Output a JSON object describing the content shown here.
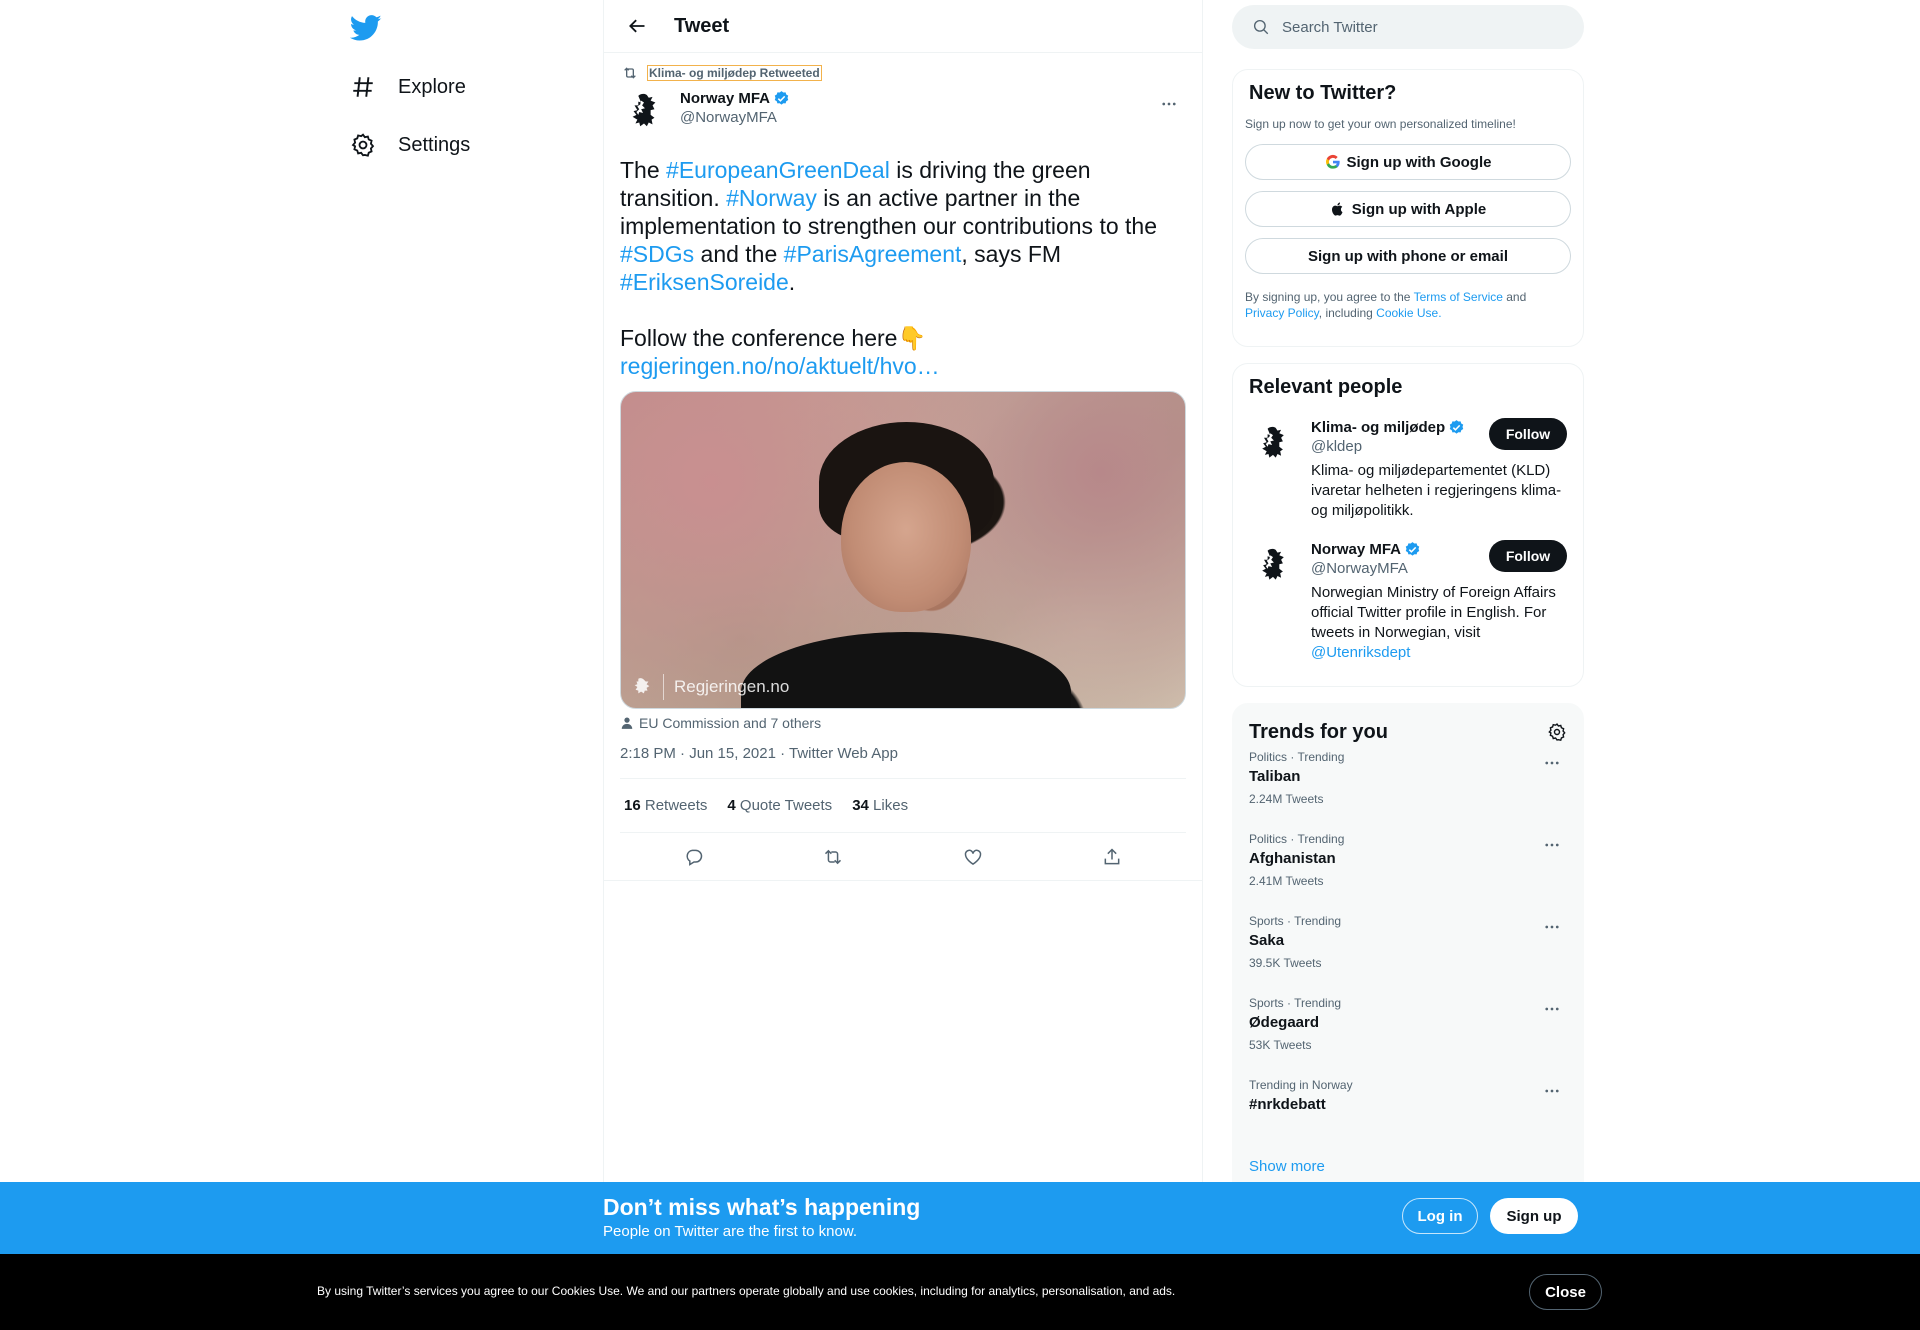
{
  "nav": {
    "logo": "twitter-bird-icon",
    "items": [
      {
        "label": "Explore",
        "icon": "hashtag-icon"
      },
      {
        "label": "Settings",
        "icon": "gear-icon"
      }
    ]
  },
  "header": {
    "title": "Tweet"
  },
  "tweet": {
    "retweeted_by": "Klima- og miljødep Retweeted",
    "author_name": "Norway MFA",
    "author_handle": "@NorwayMFA",
    "text": {
      "p1_a": "The ",
      "p1_tag1": "#EuropeanGreenDeal",
      "p1_b": " is driving the green transition. ",
      "p1_tag2": "#Norway",
      "p1_c": " is an active partner in the implementation to strengthen our contributions to the ",
      "p1_tag3": "#SDGs",
      "p1_d": " and the ",
      "p1_tag4": "#ParisAgreement",
      "p1_e": ", says FM ",
      "p1_tag5": "#EriksenSoreide",
      "p1_f": ".",
      "p2": "Follow the conference here👇",
      "link": "regjeringen.no/no/aktuelt/hvo…"
    },
    "media_watermark": "Regjeringen.no",
    "tagged": "EU Commission and 7 others",
    "meta": "2:18 PM · Jun 15, 2021 · Twitter Web App",
    "stats": {
      "retweets_count": "16",
      "retweets_label": "Retweets",
      "quotes_count": "4",
      "quotes_label": "Quote Tweets",
      "likes_count": "34",
      "likes_label": "Likes"
    }
  },
  "search": {
    "placeholder": "Search Twitter"
  },
  "new_to_twitter": {
    "title": "New to Twitter?",
    "subtitle": "Sign up now to get your own personalized timeline!",
    "google": "Sign up with Google",
    "apple": "Sign up with Apple",
    "phone": "Sign up with phone or email",
    "legal_a": "By signing up, you agree to the ",
    "terms": "Terms of Service",
    "legal_b": " and ",
    "privacy": "Privacy Policy",
    "legal_c": ", including ",
    "cookie": "Cookie Use."
  },
  "relevant": {
    "title": "Relevant people",
    "people": [
      {
        "name": "Klima- og miljødep",
        "handle": "@kldep",
        "bio": "Klima- og miljødepartementet (KLD) ivaretar helheten i regjeringens klima- og miljøpolitikk.",
        "follow": "Follow"
      },
      {
        "name": "Norway MFA",
        "handle": "@NorwayMFA",
        "bio": "Norwegian Ministry of Foreign Affairs official Twitter profile in English. For tweets in Norwegian, visit ",
        "bio_link": "@Utenriksdept",
        "follow": "Follow"
      }
    ]
  },
  "trends": {
    "title": "Trends for you",
    "items": [
      {
        "context": "Politics · Trending",
        "name": "Taliban",
        "count": "2.24M Tweets"
      },
      {
        "context": "Politics · Trending",
        "name": "Afghanistan",
        "count": "2.41M Tweets"
      },
      {
        "context": "Sports · Trending",
        "name": "Saka",
        "count": "39.5K Tweets"
      },
      {
        "context": "Sports · Trending",
        "name": "Ødegaard",
        "count": "53K Tweets"
      },
      {
        "context": "Trending in Norway",
        "name": "#nrkdebatt",
        "count": ""
      }
    ],
    "show_more": "Show more"
  },
  "banner": {
    "title": "Don’t miss what’s happening",
    "subtitle": "People on Twitter are the first to know.",
    "login": "Log in",
    "signup": "Sign up"
  },
  "cookie": {
    "text": "By using Twitter’s services you agree to our Cookies Use. We and our partners operate globally and use cookies, including for analytics, personalisation, and ads.",
    "close": "Close"
  },
  "colors": {
    "accent": "#1d9bf0",
    "text": "#0f1419",
    "muted": "#536471",
    "cookie_bg": "#000000"
  }
}
